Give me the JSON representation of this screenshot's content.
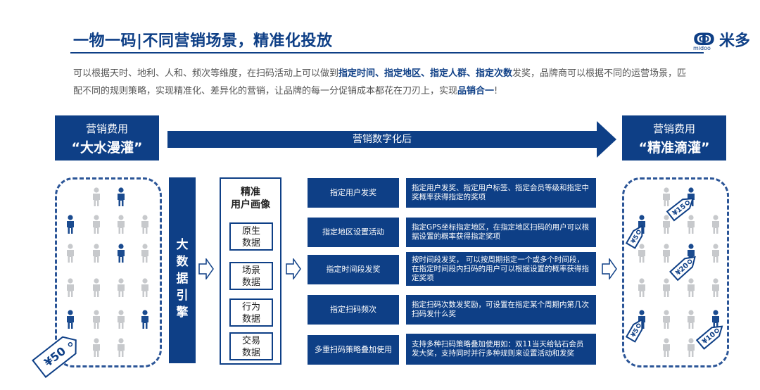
{
  "header": {
    "title": "一物一码|不同营销场景，精准化投放",
    "logo_text": "米多",
    "logo_sub": "midoo"
  },
  "description": {
    "p1": "可以根据天时、地利、人和、频次等维度，在扫码活动上可以做到",
    "b1": "指定时间、指定地区、指定人群、指定次数",
    "p2": "发奖，品牌商可以根据不同的运营场景，匹配不同的规则策略，实现精准化、差异化的营销，让品牌的每一分促销成本都花在刀刃上，实现",
    "b2": "品销合一",
    "p3": "!"
  },
  "band": {
    "left_l1": "营销费用",
    "left_l2": "“大水漫灌”",
    "middle": "营销数字化后",
    "right_l1": "营销费用",
    "right_l2": "“精准滴灌”"
  },
  "engine": {
    "label": "大数据引擎"
  },
  "portrait": {
    "title_l1": "精准",
    "title_l2": "用户画像",
    "items": [
      "原生\n数据",
      "场景\n数据",
      "行为\n数据",
      "交易\n数据"
    ]
  },
  "rules": [
    {
      "name": "指定用户发奖",
      "detail": "指定用户发奖、指定用户标签、指定会员等级和指定中奖概率获得指定的奖项"
    },
    {
      "name": "指定地区设置活动",
      "detail": "指定GPS坐标指定地区，在指定地区扫码的用户可以根据设置的概率获得指定奖项"
    },
    {
      "name": "指定时间段发奖",
      "detail": "按时间段发奖，  可以按周期指定一个或多个时间段，在指定时间段内扫码的用户可以根据设置的概率获得指定奖项"
    },
    {
      "name": "指定扫码频次",
      "detail": "指定扫码次数发奖励，可设置在指定某个周期内第几次扫码发什么奖"
    },
    {
      "name": "多重扫码策略叠加使用",
      "detail": "支持多种扫码策略叠加使用如：双11当天给钻石会员发大奖，支持同时并行多种规则来设置活动和发奖"
    }
  ],
  "price_tags": {
    "left": "¥50",
    "right": [
      "¥15",
      "¥5",
      "¥20",
      "¥5",
      "¥10"
    ]
  },
  "colors": {
    "primary": "#0e3f86",
    "person_blue": "#1b4b8f",
    "person_gray": "#c7c9cc"
  }
}
